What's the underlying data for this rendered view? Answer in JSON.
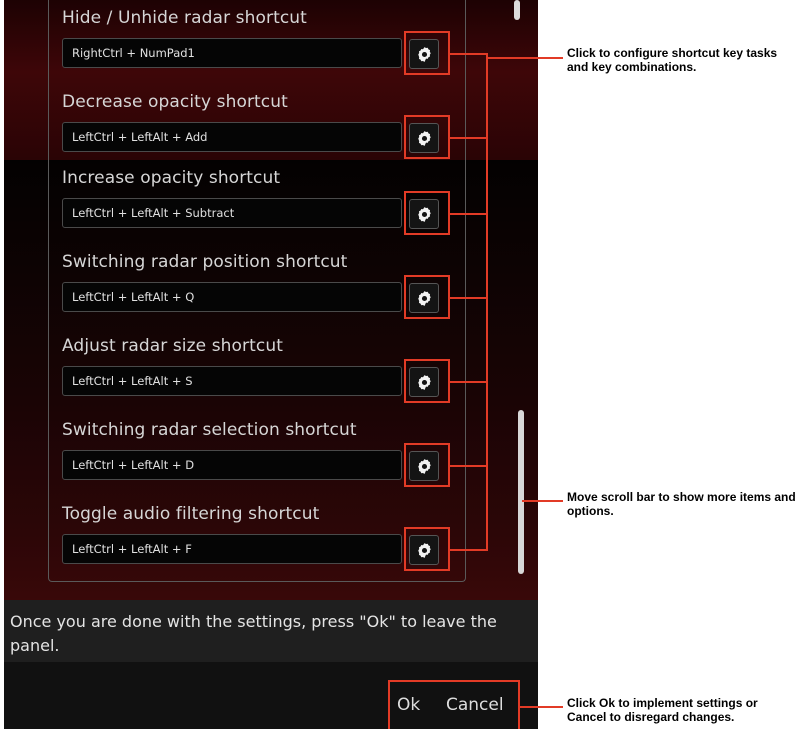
{
  "shortcuts": [
    {
      "label": "Hide / Unhide radar shortcut",
      "value": "RightCtrl + NumPad1"
    },
    {
      "label": "Decrease opacity shortcut",
      "value": "LeftCtrl + LeftAlt + Add"
    },
    {
      "label": "Increase opacity shortcut",
      "value": "LeftCtrl + LeftAlt + Subtract"
    },
    {
      "label": "Switching radar position shortcut",
      "value": "LeftCtrl + LeftAlt + Q"
    },
    {
      "label": "Adjust radar size shortcut",
      "value": "LeftCtrl + LeftAlt + S"
    },
    {
      "label": "Switching radar selection shortcut",
      "value": "LeftCtrl + LeftAlt + D"
    },
    {
      "label": "Toggle audio filtering shortcut",
      "value": "LeftCtrl + LeftAlt + F"
    }
  ],
  "footer": {
    "message": "Once you are done with the settings, press \"Ok\" to leave the panel.",
    "ok_label": "Ok",
    "cancel_label": "Cancel"
  },
  "callouts": {
    "configure": "Click to configure shortcut key tasks and key combinations.",
    "scroll": "Move scroll bar to show more items and options.",
    "ok_cancel": "Click Ok to implement settings or Cancel to disregard changes."
  },
  "icons": {
    "config_button": "gear-icon"
  },
  "colors": {
    "callout_red": "#e23b26",
    "panel_bg": "#0a0a0a",
    "accent_red": "#3e0608"
  }
}
